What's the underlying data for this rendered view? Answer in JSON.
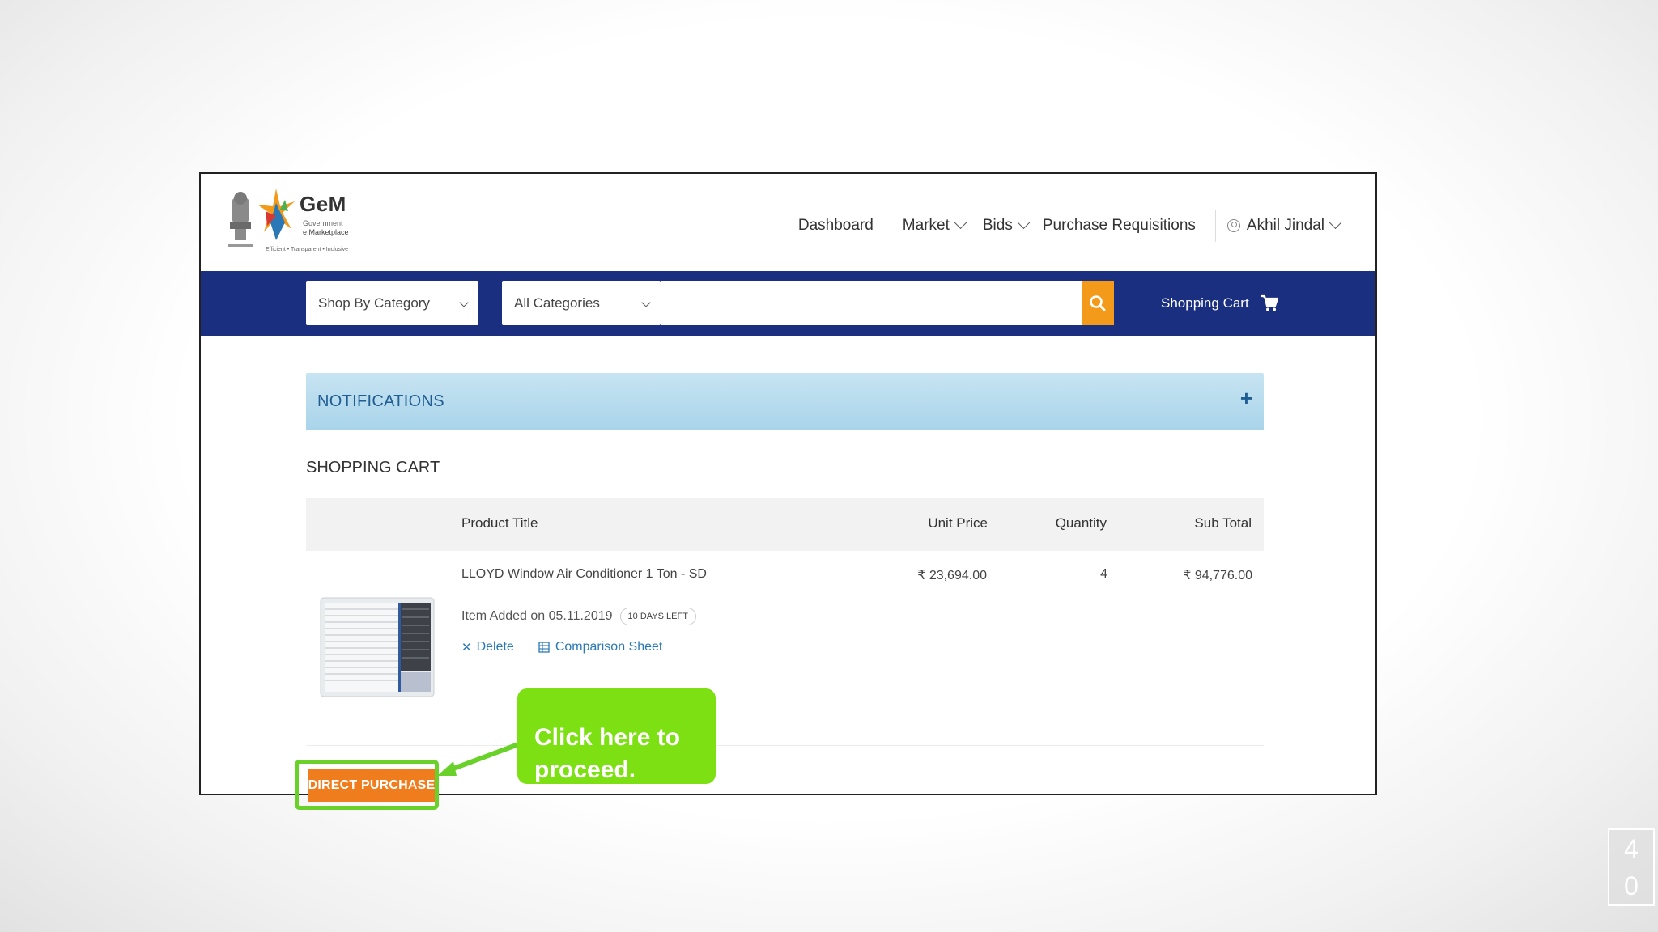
{
  "header": {
    "logo_title": "GeM",
    "logo_sub1": "Government",
    "logo_sub2": "e Marketplace",
    "logo_tagline": "Efficient • Transparent • Inclusive",
    "nav": {
      "dashboard": "Dashboard",
      "market": "Market",
      "bids": "Bids",
      "requisitions": "Purchase Requisitions",
      "user": "Akhil Jindal"
    }
  },
  "searchbar": {
    "shop_by_category": "Shop By Category",
    "all_categories": "All Categories",
    "search_placeholder": "",
    "cart_label": "Shopping Cart"
  },
  "notifications": {
    "title": "NOTIFICATIONS",
    "expand": "+"
  },
  "cart": {
    "title": "SHOPPING CART",
    "columns": {
      "product": "Product Title",
      "unit_price": "Unit Price",
      "quantity": "Quantity",
      "sub_total": "Sub Total"
    },
    "items": [
      {
        "name": "LLOYD Window Air Conditioner 1 Ton - SD",
        "unit_price": "₹ 23,694.00",
        "quantity": "4",
        "sub_total": "₹ 94,776.00",
        "added": "Item Added on 05.11.2019",
        "days_left": "10 DAYS LEFT",
        "delete_label": "Delete",
        "comparison_label": "Comparison Sheet"
      }
    ],
    "direct_purchase": "DIRECT PURCHASE"
  },
  "callout": {
    "text": "Click here to proceed."
  },
  "slide_number": {
    "line1": "4",
    "line2": "0"
  },
  "colors": {
    "navy": "#1a2f7f",
    "orange": "#f07d1d",
    "search_orange": "#f39a1b",
    "highlight_green": "#6ad12a",
    "callout_green": "#7ce013",
    "link_blue": "#2a78b5"
  }
}
